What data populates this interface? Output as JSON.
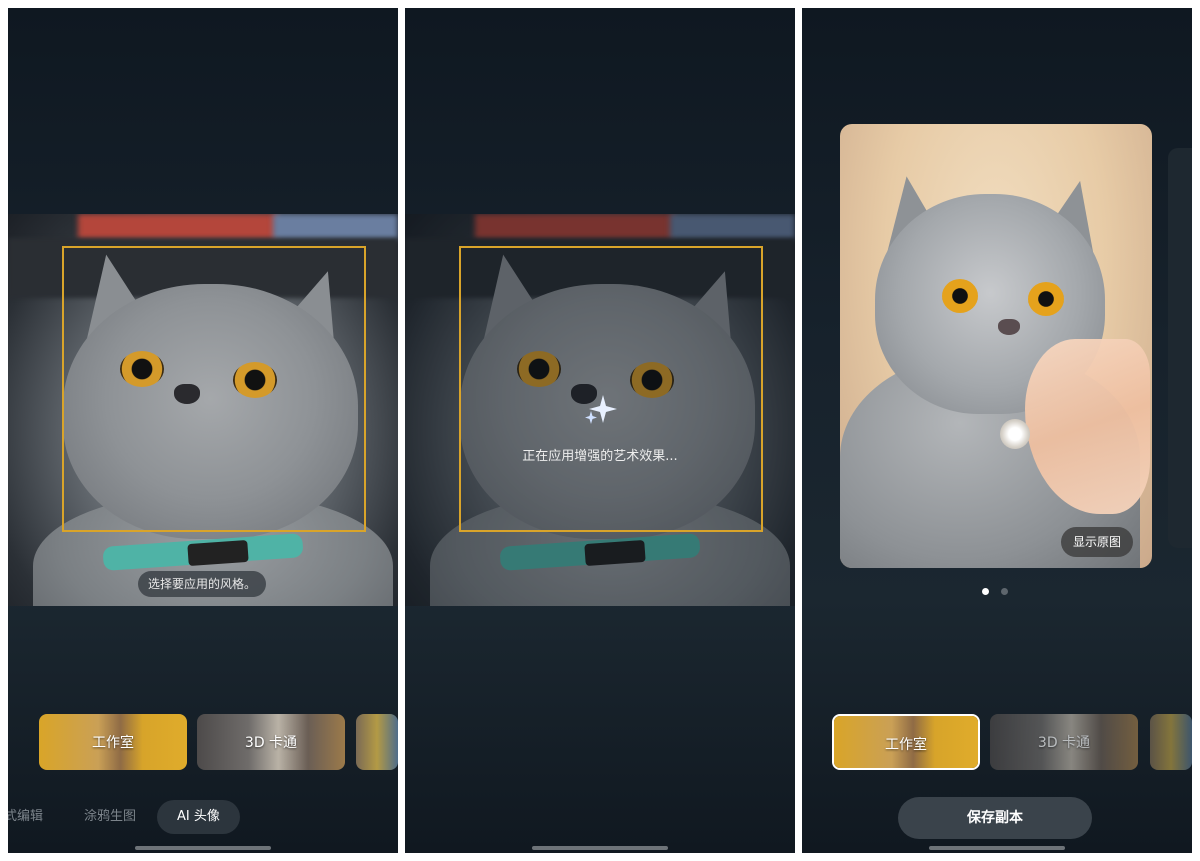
{
  "panel1": {
    "hint": "选择要应用的风格。",
    "styles": [
      {
        "label": "工作室",
        "selected": false
      },
      {
        "label": "3D 卡通",
        "selected": false
      }
    ],
    "tabs": [
      {
        "label": "式编辑",
        "active": false
      },
      {
        "label": "涂鸦生图",
        "active": false
      },
      {
        "label": "AI 头像",
        "active": true
      }
    ]
  },
  "panel2": {
    "progress_text": "正在应用增强的艺术效果..."
  },
  "panel3": {
    "show_original_label": "显示原图",
    "page_indicator": {
      "current": 1,
      "total": 2
    },
    "styles": [
      {
        "label": "工作室",
        "selected": true
      },
      {
        "label": "3D 卡通",
        "selected": false
      }
    ],
    "save_label": "保存副本"
  },
  "colors": {
    "focus_box": "#d9a42a",
    "selected_style": "#e0ac2b"
  }
}
